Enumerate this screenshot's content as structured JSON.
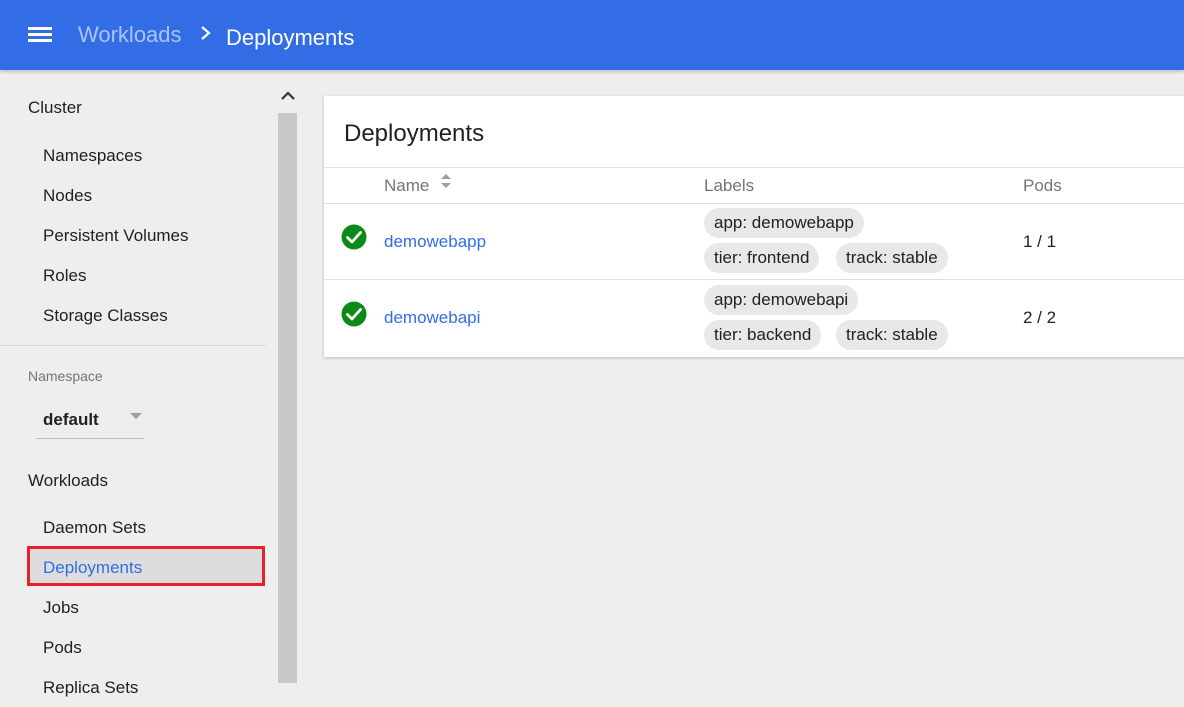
{
  "topbar": {
    "menu_icon": "hamburger-menu-icon",
    "breadcrumb_parent": "Workloads",
    "breadcrumb_separator_icon": "chevron-right-icon",
    "breadcrumb_current": "Deployments"
  },
  "sidebar": {
    "cluster": {
      "heading": "Cluster",
      "items": [
        "Namespaces",
        "Nodes",
        "Persistent Volumes",
        "Roles",
        "Storage Classes"
      ]
    },
    "namespace": {
      "label": "Namespace",
      "selected": "default"
    },
    "workloads": {
      "heading": "Workloads",
      "items": [
        "Daemon Sets",
        "Deployments",
        "Jobs",
        "Pods",
        "Replica Sets"
      ],
      "active_item": "Deployments"
    }
  },
  "main": {
    "card_title": "Deployments",
    "columns": {
      "name": "Name",
      "labels": "Labels",
      "pods": "Pods"
    },
    "rows": [
      {
        "status_icon": "check-circle-icon",
        "name": "demowebapp",
        "labels": [
          "app: demowebapp",
          "tier: frontend",
          "track: stable"
        ],
        "pods": "1 / 1"
      },
      {
        "status_icon": "check-circle-icon",
        "name": "demowebapi",
        "labels": [
          "app: demowebapi",
          "tier: backend",
          "track: stable"
        ],
        "pods": "2 / 2"
      }
    ]
  },
  "colors": {
    "brand": "#326de6",
    "status_ok": "#0b8a17",
    "highlight_border": "#e8202a"
  }
}
